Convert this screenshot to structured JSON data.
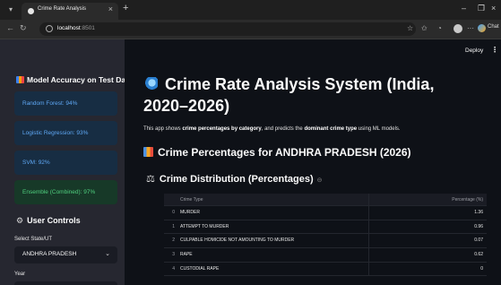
{
  "browser": {
    "tab_title": "Crime Rate Analysis",
    "url_host": "localhost",
    "url_port": ":8501",
    "chat_label": "Chat"
  },
  "sidebar": {
    "accuracy_heading": "Model Accuracy on Test Data",
    "metrics": [
      {
        "label": "Random Forest: 94%",
        "kind": "info"
      },
      {
        "label": "Logistic Regression: 93%",
        "kind": "info"
      },
      {
        "label": "SVM: 92%",
        "kind": "info"
      },
      {
        "label": "Ensemble (Combined): 97%",
        "kind": "success"
      }
    ],
    "controls_heading": "User Controls",
    "state_label": "Select State/UT",
    "state_value": "ANDHRA PRADESH",
    "year_label": "Year"
  },
  "header": {
    "deploy_label": "Deploy",
    "menu_icon": "⋮"
  },
  "main": {
    "title": "Crime Rate Analysis System (India, 2020–2026)",
    "desc_prefix": "This app shows ",
    "desc_bold1": "crime percentages by category",
    "desc_mid": ", and predicts the ",
    "desc_bold2": "dominant crime type",
    "desc_suffix": " using ML models.",
    "section_title": "Crime Percentages for ANDHRA PRADESH (2026)",
    "distribution_title": "Crime Distribution (Percentages)",
    "table": {
      "columns": [
        "Crime Type",
        "Percentage (%)"
      ],
      "rows": [
        {
          "index": "0",
          "type": "MURDER",
          "pct": "1.36"
        },
        {
          "index": "1",
          "type": "ATTEMPT TO MURDER",
          "pct": "0.96"
        },
        {
          "index": "2",
          "type": "CULPABLE HOMICIDE NOT AMOUNTING TO MURDER",
          "pct": "0.07"
        },
        {
          "index": "3",
          "type": "RAPE",
          "pct": "0.62"
        },
        {
          "index": "4",
          "type": "CUSTODIAL RAPE",
          "pct": "0"
        }
      ]
    }
  },
  "colors": {
    "sidebar_bg": "#262730",
    "main_bg": "#0e1117",
    "info_bg": "#172d43",
    "info_text": "#5fa8f5",
    "success_bg": "#173928",
    "success_text": "#4fcf7e"
  }
}
